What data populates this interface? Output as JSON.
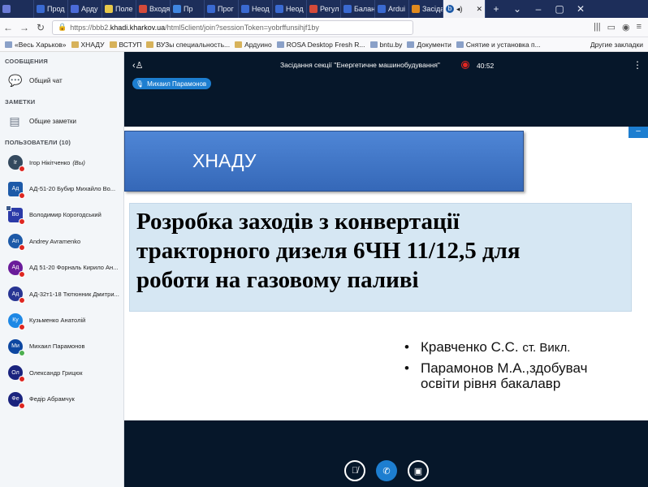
{
  "browser": {
    "tabs": [
      {
        "label": "",
        "color": "#6b7bd6"
      },
      {
        "label": "Прод",
        "color": "#3a6ad1"
      },
      {
        "label": "Арду",
        "color": "#4b6bd8"
      },
      {
        "label": "Поле",
        "color": "#e6c84a"
      },
      {
        "label": "Входя",
        "color": "#d44a3a"
      },
      {
        "label": "Пр",
        "color": "#3f86e0"
      },
      {
        "label": "Прог",
        "color": "#3a6ad1"
      },
      {
        "label": "Неод",
        "color": "#3a6ad1"
      },
      {
        "label": "Неод",
        "color": "#3a6ad1"
      },
      {
        "label": "Регул",
        "color": "#d44a3a"
      },
      {
        "label": "Балан",
        "color": "#3a6ad1"
      },
      {
        "label": "Ardui",
        "color": "#3a6ad1"
      },
      {
        "label": "Засіда",
        "color": "#e08a1e"
      }
    ],
    "active_tab": {
      "label": "",
      "icon": "b"
    },
    "url_prefix": "https://bbb2.",
    "url_host": "khadi.kharkov.ua",
    "url_rest": "/html5client/join?sessionToken=yobrffunsihjf1by",
    "bookmarks": [
      {
        "label": "«Весь Харьков»",
        "type": "page"
      },
      {
        "label": "ХНАДУ",
        "type": "folder"
      },
      {
        "label": "ВСТУП",
        "type": "folder"
      },
      {
        "label": "ВУЗы специальность...",
        "type": "folder"
      },
      {
        "label": "Ардуино",
        "type": "folder"
      },
      {
        "label": "ROSA Desktop Fresh R...",
        "type": "page"
      },
      {
        "label": "bntu.by",
        "type": "page"
      },
      {
        "label": "Документи",
        "type": "page"
      },
      {
        "label": "Снятие и установка п...",
        "type": "page"
      }
    ],
    "other_bookmarks": "Другие закладки"
  },
  "sidebar": {
    "messages_title": "СООБЩЕНИЯ",
    "public_chat": "Общий чат",
    "notes_title": "ЗАМЕТКИ",
    "shared_notes": "Общие заметки",
    "users_title": "ПОЛЬЗОВАТЕЛИ (10)",
    "users": [
      {
        "initials": "Ir",
        "name": "Ігор Нікітченко",
        "suffix": "(Вы)",
        "color": "#34495e",
        "status": "red",
        "square": false
      },
      {
        "initials": "Ад",
        "name": "АД-51-20 Бубир Михайло Во...",
        "suffix": "",
        "color": "#1d5aa8",
        "status": "red",
        "square": true
      },
      {
        "initials": "Во",
        "name": "Володимир Корогодський",
        "suffix": "",
        "color": "#2b3aa8",
        "status": "red",
        "square": true,
        "presenter": true
      },
      {
        "initials": "An",
        "name": "Andrey Avramenko",
        "suffix": "",
        "color": "#1d5aa8",
        "status": "red",
        "square": false
      },
      {
        "initials": "Ад",
        "name": "АД 51-20 Форналь Кирило Ан...",
        "suffix": "",
        "color": "#6a1b9a",
        "status": "red",
        "square": false
      },
      {
        "initials": "Ад",
        "name": "АД-32т1-18 Тютюнник Дмитри...",
        "suffix": "",
        "color": "#283593",
        "status": "red",
        "square": false
      },
      {
        "initials": "Ку",
        "name": "Кузьменко Анатолій",
        "suffix": "",
        "color": "#1e88e5",
        "status": "red",
        "square": false
      },
      {
        "initials": "Ми",
        "name": "Михаил Парамонов",
        "suffix": "",
        "color": "#0d47a1",
        "status": "green",
        "square": false
      },
      {
        "initials": "Ол",
        "name": "Олександр Грицюк",
        "suffix": "",
        "color": "#1a237e",
        "status": "red",
        "square": false
      },
      {
        "initials": "Фе",
        "name": "Федір Абрамчук",
        "suffix": "",
        "color": "#1a237e",
        "status": "red",
        "square": false
      }
    ]
  },
  "meeting": {
    "title": "Засідання секції \"Енергетичне машинобудування\"",
    "recording_time": "40:52",
    "talking_user": "Михаил Парамонов"
  },
  "slide": {
    "banner": "ХНАДУ",
    "title_lines": [
      "Розробка заходів з конвертації",
      "тракторного дизеля 6ЧН 11/12,5 для",
      "роботи на газовому паливі"
    ],
    "author1_name": "Кравченко С.С.",
    "author1_role": "ст. Викл.",
    "author2_line1": "Парамонов М.А.,здобувач",
    "author2_line2": "освіти рівня бакалавр"
  }
}
